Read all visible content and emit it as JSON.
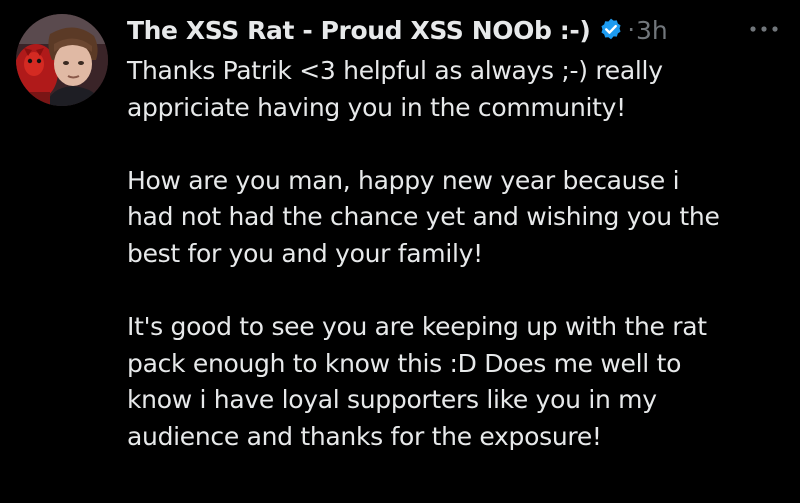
{
  "tweet": {
    "author": {
      "display_name": "The XSS Rat - Proud XSS NOOb :-)",
      "verified_icon": "verified-badge-icon",
      "avatar": "avatar"
    },
    "separator": "·",
    "timestamp": "3h",
    "more_icon": "more-options-icon",
    "body": {
      "paragraphs": [
        {
          "lines": [
            "Thanks Patrik <3 helpful as always ;-) really",
            "appriciate having you in the community!"
          ]
        },
        {
          "lines": [
            "How are you man, happy new year because i",
            "had not had the chance yet and wishing you the",
            "best for you and your family!"
          ]
        },
        {
          "lines": [
            "It's good to see you are keeping up with the rat",
            "pack enough to know this :D Does me well to",
            "know i have loyal supporters like you in my",
            "audience and thanks for the exposure!"
          ]
        }
      ]
    }
  },
  "colors": {
    "background": "#000000",
    "text": "#e7e9ea",
    "secondary": "#71767b",
    "verified": "#1d9bf0"
  }
}
